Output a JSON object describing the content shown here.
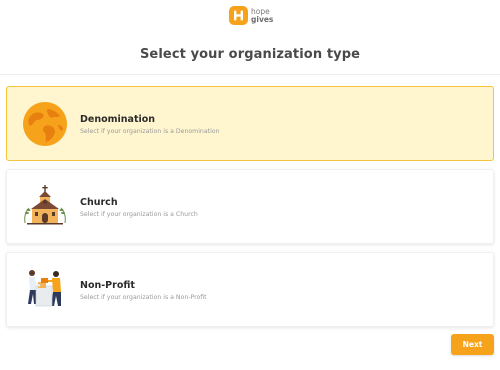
{
  "brand": {
    "line1": "hope",
    "line2": "gives",
    "accent": "#f7a21b"
  },
  "page": {
    "title": "Select your organization type"
  },
  "options": [
    {
      "name": "Denomination",
      "description": "Select if your organization is a Denomination",
      "icon": "globe-icon",
      "selected": true
    },
    {
      "name": "Church",
      "description": "Select if your organization is a Church",
      "icon": "church-icon",
      "selected": false
    },
    {
      "name": "Non-Profit",
      "description": "Select if your organization is a Non-Profit",
      "icon": "volunteers-icon",
      "selected": false
    }
  ],
  "actions": {
    "next_label": "Next"
  },
  "colors": {
    "selected_bg": "#fff6cf",
    "selected_border": "#f5c43a",
    "button": "#f7a21b"
  }
}
